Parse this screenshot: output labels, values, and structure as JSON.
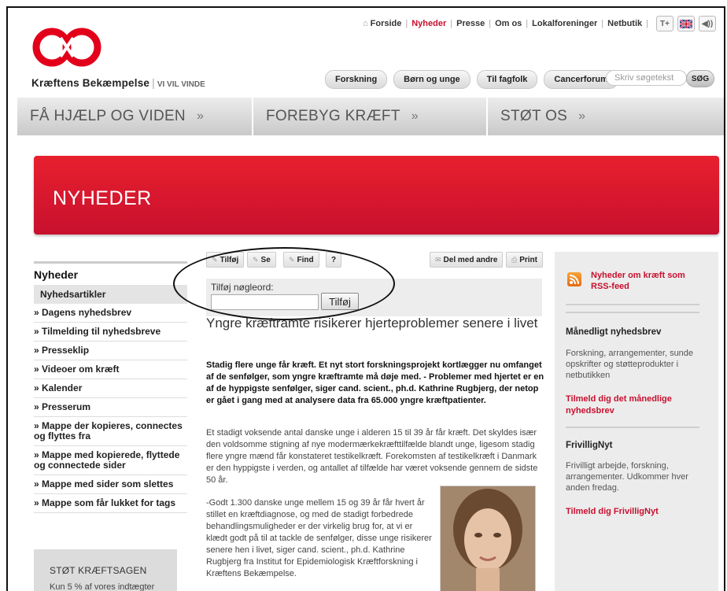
{
  "utility_nav": {
    "home_label": "Forside",
    "items": [
      "Nyheder",
      "Presse",
      "Om os",
      "Lokalforeninger",
      "Netbutik"
    ],
    "active": "Nyheder",
    "text_size_icon": "T+",
    "language_icon": "uk-flag-icon",
    "audio_icon": "speaker-icon"
  },
  "brand": {
    "name": "Kræftens Bekæmpelse",
    "tagline": "VI VIL VINDE",
    "color": "#e2001a"
  },
  "header_buttons": [
    "Forskning",
    "Børn og unge",
    "Til fagfolk",
    "Cancerforum"
  ],
  "search": {
    "placeholder": "Skriv søgetekst",
    "button_label": "SØG"
  },
  "main_nav": [
    "FÅ HJÆLP OG VIDEN",
    "FOREBYG KRÆFT",
    "STØT OS"
  ],
  "main_nav_chevron": "»",
  "banner": {
    "title": "NYHEDER",
    "color": "#d71927"
  },
  "left_nav": {
    "heading": "Nyheder",
    "current": "Nyhedsartikler",
    "items": [
      "» Dagens nyhedsbrev",
      "» Tilmelding til nyhedsbreve",
      "» Presseklip",
      "» Videoer om kræft",
      "» Kalender",
      "» Presserum",
      "» Mappe der kopieres, connectes og flyttes fra",
      "» Mappe med kopierede, flyttede og connectede sider",
      "» Mappe med sider som slettes",
      "» Mappe som får lukket for tags"
    ]
  },
  "support_box": {
    "title": "STØT KRÆFTSAGEN",
    "text": "Kun 5 % af vores indtægter"
  },
  "toolbar": {
    "add_label": "Tilføj",
    "see_label": "Se",
    "find_label": "Find",
    "help_label": "?",
    "share_label": "Del med andre",
    "print_label": "Print"
  },
  "keyword": {
    "label": "Tilføj nøgleord:",
    "value": "",
    "button_label": "Tilføj"
  },
  "article": {
    "title": "Yngre kræftramte risikerer hjerteproblemer senere i livet",
    "lead": "Stadig flere unge får kræft. Et nyt stort forskningsprojekt kortlægger nu omfanget af de senfølger, som yngre kræftramte må døje med. - Problemer med hjertet er en af de hyppigste senfølger, siger cand. scient., ph.d. Kathrine Rugbjerg, der netop er gået i gang med at analysere data fra 65.000 yngre kræftpatienter.",
    "paragraph1": "Et stadigt voksende antal danske unge i alderen 15 til 39 år får kræft. Det skyldes især den voldsomme stigning af nye modermærkekræfttilfælde blandt unge, ligesom stadig flere yngre mænd får konstateret testikelkræft. Forekomsten af testikelkræft i Danmark er den hyppigste i verden, og antallet af tilfælde har været voksende gennem de sidste 50 år.",
    "paragraph2": "-Godt 1.300 danske unge mellem 15 og 39 år får hvert år stillet en kræftdiagnose, og med de stadigt forbedrede behandlingsmuligheder er der virkelig brug for, at vi er klædt godt på til at tackle de senfølger, disse unge risikerer senere hen i livet, siger cand. scient., ph.d. Kathrine Rugbjerg fra Institut for Epidemiologisk Kræftforskning i Kræftens Bekæmpelse."
  },
  "right_column": {
    "rss_label": "Nyheder om kræft som RSS-feed",
    "newsletter_title": "Månedligt nyhedsbrev",
    "newsletter_text": "Forskning, arrangementer, sunde opskrifter og støtteprodukter i netbutikken",
    "newsletter_link": "Tilmeld dig det månedlige nyhedsbrev",
    "volunteer_title": "FrivilligNyt",
    "volunteer_text": "Frivilligt arbejde, forskning, arrangementer. Udkommer hver anden fredag.",
    "volunteer_link": "Tilmeld dig FrivilligNyt"
  }
}
